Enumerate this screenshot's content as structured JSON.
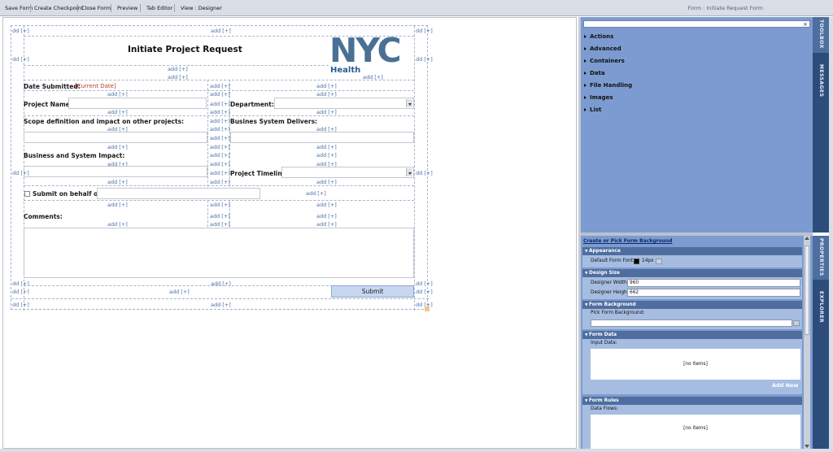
{
  "toolbar": {
    "save_form": "Save Form",
    "create_checkpoint": "Create Checkpoint",
    "close_form": "Close Form",
    "preview": "Preview",
    "tab_editor": "Tab Editor",
    "view_designer": "View : Designer",
    "window_title": "Form : Initiate Request Form"
  },
  "designer": {
    "add_label": "add [+]",
    "side_add_left": "dd [+]",
    "side_add_right": "dd [+]",
    "form_title": "Initiate Project Request",
    "logo": {
      "text": "NYC",
      "subtext": "Health",
      "color": "#4a7096"
    },
    "fields": {
      "date_submitted": "Date Submitted:",
      "current_date": "[Current Date]",
      "project_name": "Project Name:",
      "department": "Department:",
      "scope": "Scope definition and impact on other projects:",
      "business_delivers": "Busines System Delivers:",
      "business_impact": "Business and System Impact:",
      "project_timeline": "Project Timeline:",
      "submit_behalf": "Submit on behalf of:",
      "comments": "Comments:"
    },
    "submit_button": "Submit"
  },
  "toolbox": {
    "search_placeholder": "",
    "items": [
      "Actions",
      "Advanced",
      "Containers",
      "Data",
      "File Handling",
      "Images",
      "List"
    ],
    "tabs": [
      "TOOLBOX",
      "MESSAGES"
    ]
  },
  "properties": {
    "background_link": "Create or Pick Form Background",
    "tabs": [
      "PROPERTIES",
      "EXPLORER"
    ],
    "appearance": {
      "header": "Appearance",
      "font_label": "Default Form Font:",
      "font_size": "14px",
      "font_color": "#000000"
    },
    "design_size": {
      "header": "Design Size",
      "width_label": "Designer Width:",
      "width_value": "960",
      "height_label": "Designer Height:",
      "height_value": "662"
    },
    "background": {
      "header": "Form Background",
      "pick_label": "Pick Form Background:",
      "pick_value": ""
    },
    "form_data": {
      "header": "Form Data",
      "input_label": "Input Data:",
      "empty": "[no items]",
      "add_new": "Add New"
    },
    "form_rules": {
      "header": "Form Rules",
      "flows_label": "Data Flows:",
      "empty": "[no items]"
    }
  }
}
